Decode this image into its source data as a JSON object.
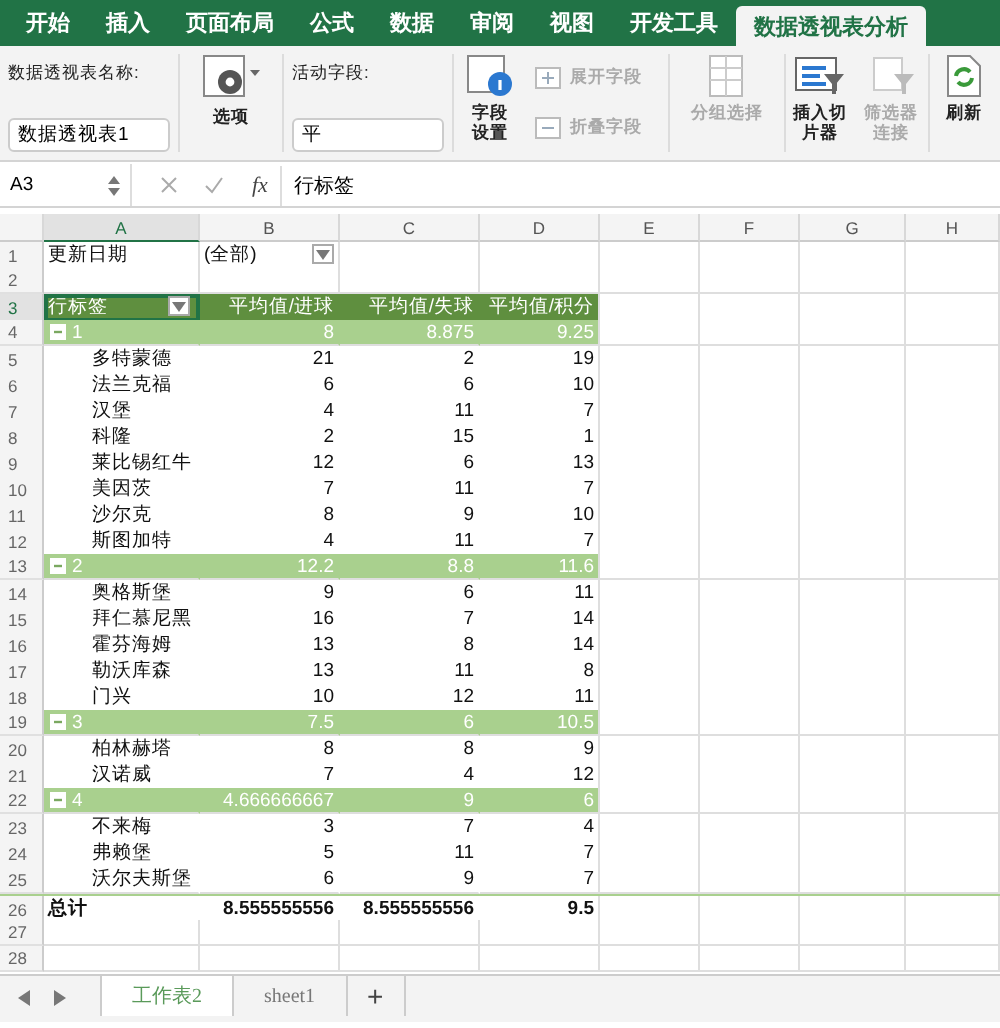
{
  "ribbon_tabs": [
    {
      "label": "开始",
      "selected": false
    },
    {
      "label": "插入",
      "selected": false
    },
    {
      "label": "页面布局",
      "selected": false
    },
    {
      "label": "公式",
      "selected": false
    },
    {
      "label": "数据",
      "selected": false
    },
    {
      "label": "审阅",
      "selected": false
    },
    {
      "label": "视图",
      "selected": false
    },
    {
      "label": "开发工具",
      "selected": false
    },
    {
      "label": "数据透视表分析",
      "selected": true
    }
  ],
  "ribbon": {
    "pivot_name_label": "数据透视表名称:",
    "pivot_name_value": "数据透视表1",
    "options_button": "选项",
    "active_field_label": "活动字段:",
    "active_field_value": "平",
    "field_settings_button": "字段设置",
    "expand_field_button": {
      "label": "展开字段",
      "disabled": true
    },
    "collapse_field_button": {
      "label": "折叠字段",
      "disabled": true
    },
    "group_selection_button": {
      "label": "分组选择",
      "disabled": true
    },
    "insert_slicer_button": {
      "label": "插入切片器",
      "disabled": false
    },
    "filter_connections_button": {
      "label": "筛选器连接",
      "disabled": true
    },
    "refresh_button": "刷新"
  },
  "formula_bar": {
    "cell_ref": "A3",
    "fx": "fx",
    "content": "行标签"
  },
  "columns": [
    "A",
    "B",
    "C",
    "D",
    "E",
    "F",
    "G",
    "H"
  ],
  "rows": [
    {
      "num": "1",
      "kind": "filter",
      "label": "更新日期",
      "value": "(全部)"
    },
    {
      "num": "2",
      "kind": "blank"
    },
    {
      "num": "3",
      "kind": "header",
      "label": "行标签",
      "values": [
        "平均值/进球",
        "平均值/失球",
        "平均值/积分"
      ]
    },
    {
      "num": "4",
      "kind": "group",
      "expanded": true,
      "label": "1",
      "values": [
        "8",
        "8.875",
        "9.25"
      ]
    },
    {
      "num": "5",
      "kind": "item",
      "label": "多特蒙德",
      "values": [
        "21",
        "2",
        "19"
      ]
    },
    {
      "num": "6",
      "kind": "item",
      "label": "法兰克福",
      "values": [
        "6",
        "6",
        "10"
      ]
    },
    {
      "num": "7",
      "kind": "item",
      "label": "汉堡",
      "values": [
        "4",
        "11",
        "7"
      ]
    },
    {
      "num": "8",
      "kind": "item",
      "label": "科隆",
      "values": [
        "2",
        "15",
        "1"
      ]
    },
    {
      "num": "9",
      "kind": "item",
      "label": "莱比锡红牛",
      "values": [
        "12",
        "6",
        "13"
      ]
    },
    {
      "num": "10",
      "kind": "item",
      "label": "美因茨",
      "values": [
        "7",
        "11",
        "7"
      ]
    },
    {
      "num": "11",
      "kind": "item",
      "label": "沙尔克",
      "values": [
        "8",
        "9",
        "10"
      ]
    },
    {
      "num": "12",
      "kind": "item",
      "label": "斯图加特",
      "values": [
        "4",
        "11",
        "7"
      ]
    },
    {
      "num": "13",
      "kind": "group",
      "expanded": true,
      "label": "2",
      "values": [
        "12.2",
        "8.8",
        "11.6"
      ]
    },
    {
      "num": "14",
      "kind": "item",
      "label": "奥格斯堡",
      "values": [
        "9",
        "6",
        "11"
      ]
    },
    {
      "num": "15",
      "kind": "item",
      "label": "拜仁慕尼黑",
      "values": [
        "16",
        "7",
        "14"
      ]
    },
    {
      "num": "16",
      "kind": "item",
      "label": "霍芬海姆",
      "values": [
        "13",
        "8",
        "14"
      ]
    },
    {
      "num": "17",
      "kind": "item",
      "label": "勒沃库森",
      "values": [
        "13",
        "11",
        "8"
      ]
    },
    {
      "num": "18",
      "kind": "item",
      "label": "门兴",
      "values": [
        "10",
        "12",
        "11"
      ]
    },
    {
      "num": "19",
      "kind": "group",
      "expanded": true,
      "label": "3",
      "values": [
        "7.5",
        "6",
        "10.5"
      ]
    },
    {
      "num": "20",
      "kind": "item",
      "label": "柏林赫塔",
      "values": [
        "8",
        "8",
        "9"
      ]
    },
    {
      "num": "21",
      "kind": "item",
      "label": "汉诺威",
      "values": [
        "7",
        "4",
        "12"
      ]
    },
    {
      "num": "22",
      "kind": "group",
      "expanded": true,
      "label": "4",
      "values": [
        "4.666666667",
        "9",
        "6"
      ]
    },
    {
      "num": "23",
      "kind": "item",
      "label": "不来梅",
      "values": [
        "3",
        "7",
        "4"
      ]
    },
    {
      "num": "24",
      "kind": "item",
      "label": "弗赖堡",
      "values": [
        "5",
        "11",
        "7"
      ]
    },
    {
      "num": "25",
      "kind": "item",
      "label": "沃尔夫斯堡",
      "values": [
        "6",
        "9",
        "7"
      ]
    },
    {
      "num": "26",
      "kind": "total",
      "label": "总计",
      "values": [
        "8.555555556",
        "8.555555556",
        "9.5"
      ]
    },
    {
      "num": "27",
      "kind": "blank"
    },
    {
      "num": "28",
      "kind": "blank"
    }
  ],
  "sheet_tabs": [
    {
      "label": "工作表2",
      "selected": true
    },
    {
      "label": "sheet1",
      "selected": false
    }
  ],
  "add_sheet": "+"
}
